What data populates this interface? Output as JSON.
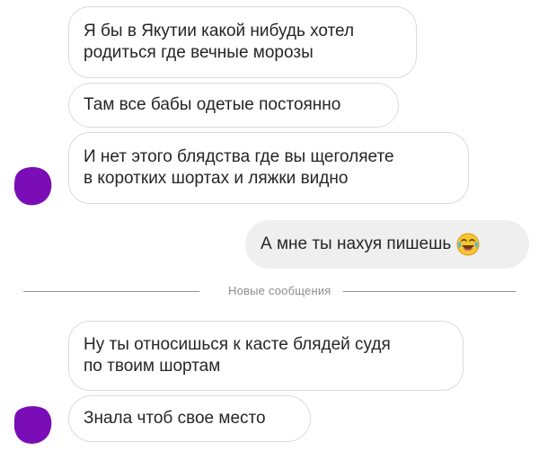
{
  "thread": {
    "messages": [
      {
        "text": "Я бы в Якутии какой нибудь хотел\nродиться где вечные морозы",
        "side": "incoming"
      },
      {
        "text": "Там все бабы одетые постоянно",
        "side": "incoming"
      },
      {
        "text": "И нет этого блядства где вы щеголяете\nв коротких шортах и ляжки видно",
        "side": "incoming"
      },
      {
        "text": "А мне ты нахуя пишешь",
        "side": "outgoing",
        "emoji": "face-with-tears-of-joy-icon"
      },
      {
        "text": "Ну ты относишься к касте блядей судя\nпо твоим шортам",
        "side": "incoming"
      },
      {
        "text": "Знала чтоб свое место",
        "side": "incoming"
      }
    ],
    "divider_label": "Новые сообщения"
  },
  "colors": {
    "avatar": "#7a0db5",
    "incoming_border": "#dbdbdb",
    "outgoing_bg": "#efefef",
    "text": "#262626",
    "divider": "#8e8e8e"
  }
}
